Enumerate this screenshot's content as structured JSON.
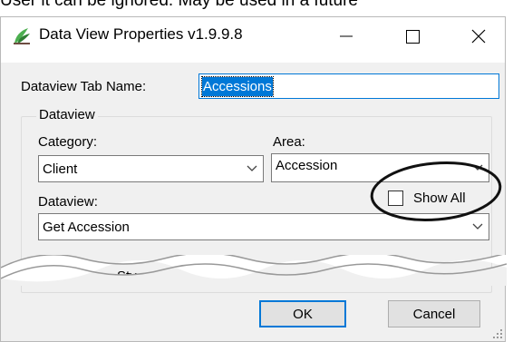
{
  "caption": {
    "text": "User it can be ignored. May be used in a future"
  },
  "window": {
    "title": "Data View Properties v1.9.9.8",
    "icon": "sprout-app-icon"
  },
  "tab_name": {
    "label": "Dataview Tab Name:",
    "value": "Accessions"
  },
  "dataview_group": {
    "title": "Dataview",
    "category": {
      "label": "Category:",
      "value": "Client"
    },
    "area": {
      "label": "Area:",
      "value": "Accession"
    },
    "show_all": {
      "label": "Show All",
      "checked": false
    },
    "dataview": {
      "label": "Dataview:",
      "value": "Get Accession"
    },
    "partial_label": "Sty"
  },
  "buttons": {
    "ok": "OK",
    "cancel": "Cancel"
  },
  "colors": {
    "accent": "#0078d7",
    "dialog_bg": "#f0f0f0",
    "icon_green": "#3c8d2f"
  }
}
